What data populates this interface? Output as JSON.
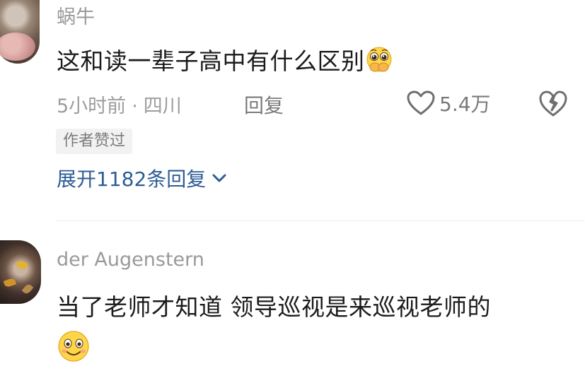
{
  "comments": [
    {
      "username": "蜗牛",
      "content": "这和读一辈子高中有什么区别",
      "emoji": "pleading-face-hands-over-mouth",
      "time": "5小时前",
      "location": "四川",
      "separator": "·",
      "reply_label": "回复",
      "like_count": "5.4万",
      "badge": "作者赞过",
      "expand_label": "展开1182条回复"
    },
    {
      "username": "der Augenstern",
      "content": "当了老师才知道 领导巡视是来巡视老师的",
      "emoji": "smiling-face"
    }
  ],
  "colors": {
    "username": "#9a9a9a",
    "content": "#1b1b1b",
    "meta": "#9d9d9d",
    "link": "#2d5d95",
    "badge_bg": "#f2f2f2"
  }
}
